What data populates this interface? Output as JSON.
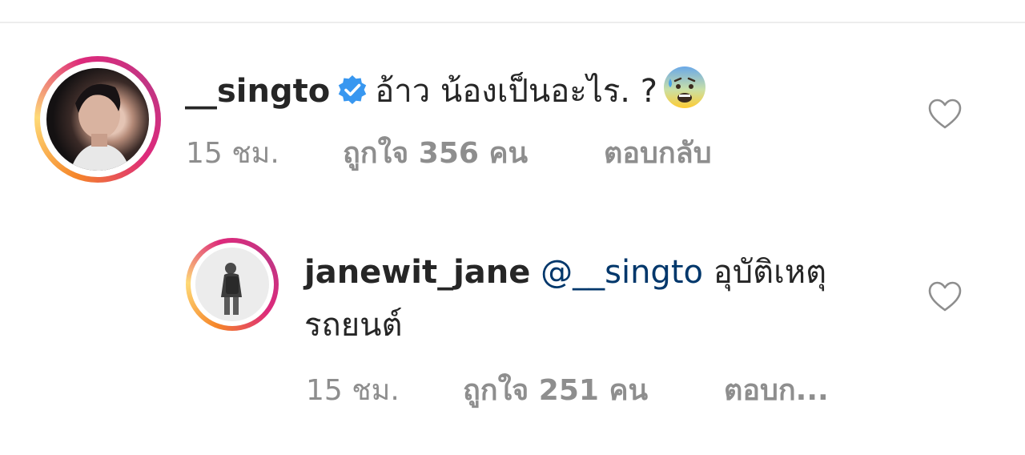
{
  "comments": [
    {
      "username": "__singto",
      "verified_icon": "verified-badge-icon",
      "text": "อ้าว น้องเป็นอะไร. ?",
      "emoji": "anxious-face-with-sweat-emoji",
      "time": "15 ชม.",
      "likes": "ถูกใจ 356 คน",
      "reply": "ตอบกลับ"
    },
    {
      "username": "janewit_jane",
      "mention": "@__singto",
      "text": "อุบัติเหตุรถยนต์",
      "time": "15 ชม.",
      "likes": "ถูกใจ 251 คน",
      "reply": "ตอบก..."
    }
  ],
  "colors": {
    "text": "#262626",
    "meta": "#8e8e8e",
    "mention": "#00376b",
    "verified": "#3897f0"
  }
}
